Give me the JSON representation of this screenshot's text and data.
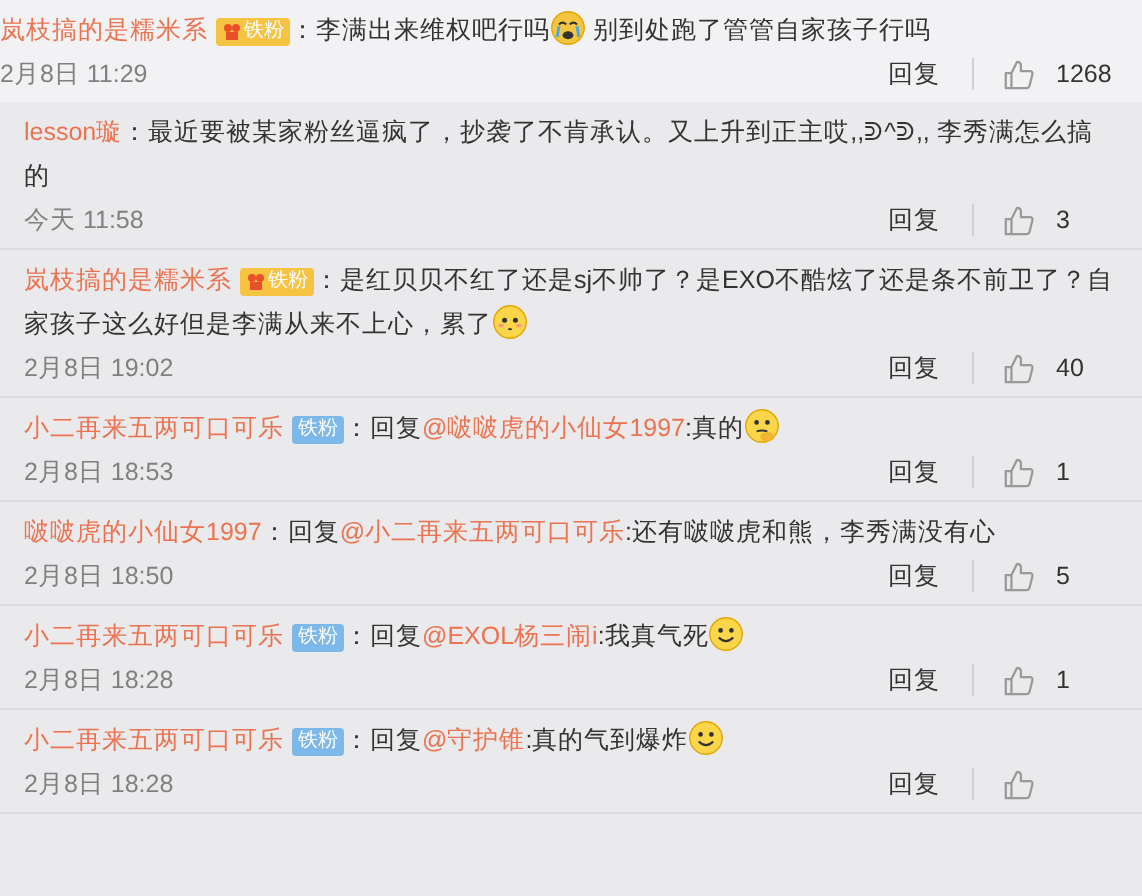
{
  "comments": [
    {
      "top": true,
      "name": "岚枝搞的是糯米系",
      "badge": {
        "kind": "gold",
        "label": "铁粉"
      },
      "colon": "：",
      "body": [
        {
          "kind": "text",
          "text": "李满出来维权吧行吗"
        },
        {
          "kind": "crying_emoji"
        },
        {
          "kind": "text",
          "text": " 别到处跑了管管自家孩子行吗"
        }
      ],
      "date": "2月8日 11:29",
      "reply": "回复",
      "likes": "1268"
    },
    {
      "top": false,
      "name": "lesson璇",
      "colon": "：",
      "body": [
        {
          "kind": "text",
          "text": "最近要被某家粉丝逼疯了，抄袭了不肯承认。又上升到正主哎,,ᕲ^ᕲ,, 李秀满怎么搞的"
        }
      ],
      "date": "今天 11:58",
      "reply": "回复",
      "likes": "3"
    },
    {
      "top": false,
      "name": "岚枝搞的是糯米系",
      "badge": {
        "kind": "gold",
        "label": "铁粉"
      },
      "colon": "：",
      "body": [
        {
          "kind": "text",
          "text": "是红贝贝不红了还是sj不帅了？是EXO不酷炫了还是条不前卫了？自家孩子这么好但是李满从来不上心，累了"
        },
        {
          "kind": "blush_emoji"
        }
      ],
      "date": "2月8日 19:02",
      "reply": "回复",
      "likes": "40"
    },
    {
      "top": false,
      "name": "小二再来五两可口可乐",
      "badge": {
        "kind": "blue",
        "label": "铁粉"
      },
      "colon": "：",
      "body": [
        {
          "kind": "text",
          "text": "回复"
        },
        {
          "kind": "mention",
          "text": "@啵啵虎的小仙女1997"
        },
        {
          "kind": "text",
          "text": ":真的"
        },
        {
          "kind": "thinking_emoji"
        }
      ],
      "date": "2月8日 18:53",
      "reply": "回复",
      "likes": "1"
    },
    {
      "top": false,
      "name": "啵啵虎的小仙女1997",
      "colon": "：",
      "body": [
        {
          "kind": "text",
          "text": "回复"
        },
        {
          "kind": "mention",
          "text": "@小二再来五两可口可乐"
        },
        {
          "kind": "text",
          "text": ":还有啵啵虎和熊，李秀满没有心"
        }
      ],
      "date": "2月8日 18:50",
      "reply": "回复",
      "likes": "5"
    },
    {
      "top": false,
      "name": "小二再来五两可口可乐",
      "badge": {
        "kind": "blue",
        "label": "铁粉"
      },
      "colon": "：",
      "body": [
        {
          "kind": "text",
          "text": "回复"
        },
        {
          "kind": "mention",
          "text": "@EXOL杨三闹i"
        },
        {
          "kind": "text",
          "text": ":我真气死"
        },
        {
          "kind": "smile_emoji"
        }
      ],
      "date": "2月8日 18:28",
      "reply": "回复",
      "likes": "1"
    },
    {
      "top": false,
      "name": "小二再来五两可口可乐",
      "badge": {
        "kind": "blue",
        "label": "铁粉"
      },
      "colon": "：",
      "body": [
        {
          "kind": "text",
          "text": "回复"
        },
        {
          "kind": "mention",
          "text": "@守护锥"
        },
        {
          "kind": "text",
          "text": ":真的气到爆炸"
        },
        {
          "kind": "smile_emoji"
        }
      ],
      "date": "2月8日 18:28",
      "reply": "回复"
    }
  ]
}
